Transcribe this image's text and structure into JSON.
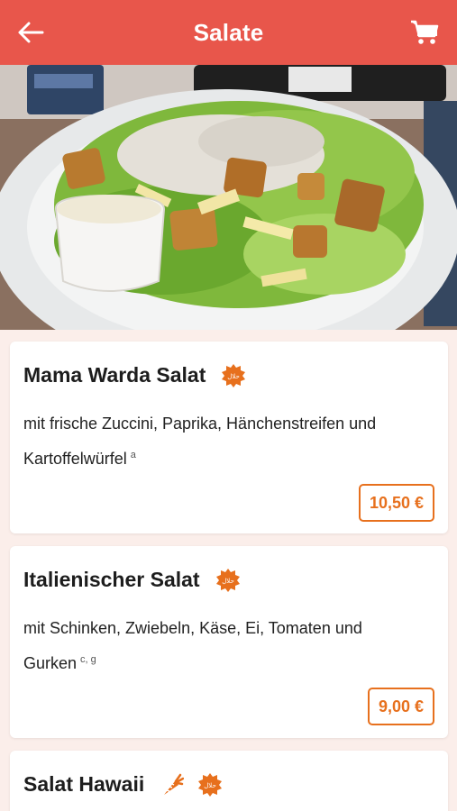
{
  "header": {
    "title": "Salate",
    "back_icon": "arrow-left-icon",
    "cart_icon": "shopping-cart-icon",
    "bg_color": "#e8564b"
  },
  "hero": {
    "alt": "Caesar-Salat mit Hähnchen, Croutons und Parmesan"
  },
  "items": [
    {
      "name": "Mama Warda Salat",
      "description": "mit frische Zuccini, Paprika, Hänchenstreifen und Kartoffelwürfel",
      "allergens": "a",
      "price": "10,50 €",
      "badges": [
        "halal-badge-icon"
      ]
    },
    {
      "name": "Italienischer Salat",
      "description": "mit Schinken, Zwiebeln, Käse, Ei, Tomaten und Gurken",
      "allergens": "c, g",
      "price": "9,00 €",
      "badges": [
        "halal-badge-icon"
      ]
    },
    {
      "name": "Salat Hawaii",
      "badges": [
        "carrot-vegetarian-icon",
        "halal-badge-icon"
      ]
    }
  ],
  "accent_color": "#e7701d",
  "badge_text": "حلال"
}
